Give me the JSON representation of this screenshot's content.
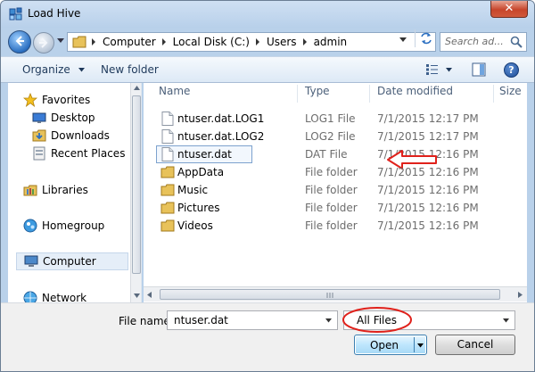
{
  "window": {
    "title": "Load Hive",
    "close_glyph": "✕"
  },
  "address_bar": {
    "crumbs": [
      "Computer",
      "Local Disk (C:)",
      "Users",
      "admin"
    ]
  },
  "search": {
    "placeholder": "Search ad..."
  },
  "toolbar": {
    "organize_label": "Organize",
    "new_folder_label": "New folder",
    "help_glyph": "?"
  },
  "nav_pane": {
    "items": [
      {
        "label": "Favorites",
        "icon": "star-icon"
      },
      {
        "label": "Desktop",
        "icon": "desktop-icon"
      },
      {
        "label": "Downloads",
        "icon": "downloads-icon"
      },
      {
        "label": "Recent Places",
        "icon": "recent-places-icon"
      },
      {
        "label": "Libraries",
        "icon": "libraries-icon"
      },
      {
        "label": "Homegroup",
        "icon": "homegroup-icon"
      },
      {
        "label": "Computer",
        "icon": "computer-icon",
        "selected": true
      },
      {
        "label": "Network",
        "icon": "network-icon"
      }
    ]
  },
  "file_list": {
    "columns": [
      "Name",
      "Type",
      "Date modified",
      "Size"
    ],
    "rows": [
      {
        "name": "ntuser.dat.LOG1",
        "type": "LOG1 File",
        "date": "7/1/2015 12:17 PM",
        "icon": "file-icon"
      },
      {
        "name": "ntuser.dat.LOG2",
        "type": "LOG2 File",
        "date": "7/1/2015 12:17 PM",
        "icon": "file-icon"
      },
      {
        "name": "ntuser.dat",
        "type": "DAT File",
        "date": "7/1/2015 12:16 PM",
        "icon": "file-icon",
        "selected": true
      },
      {
        "name": "AppData",
        "type": "File folder",
        "date": "7/1/2015 12:16 PM",
        "icon": "folder-icon"
      },
      {
        "name": "Music",
        "type": "File folder",
        "date": "7/1/2015 12:16 PM",
        "icon": "folder-icon"
      },
      {
        "name": "Pictures",
        "type": "File folder",
        "date": "7/1/2015 12:16 PM",
        "icon": "folder-icon"
      },
      {
        "name": "Videos",
        "type": "File folder",
        "date": "7/1/2015 12:16 PM",
        "icon": "folder-icon"
      }
    ]
  },
  "bottom": {
    "file_name_label": "File name:",
    "file_name_value": "ntuser.dat",
    "file_type_filter": "All Files",
    "open_label": "Open",
    "cancel_label": "Cancel"
  },
  "colors": {
    "annotation_red": "#e0211b",
    "selection_border": "#7da2ce",
    "open_button": "#bee6fd"
  }
}
